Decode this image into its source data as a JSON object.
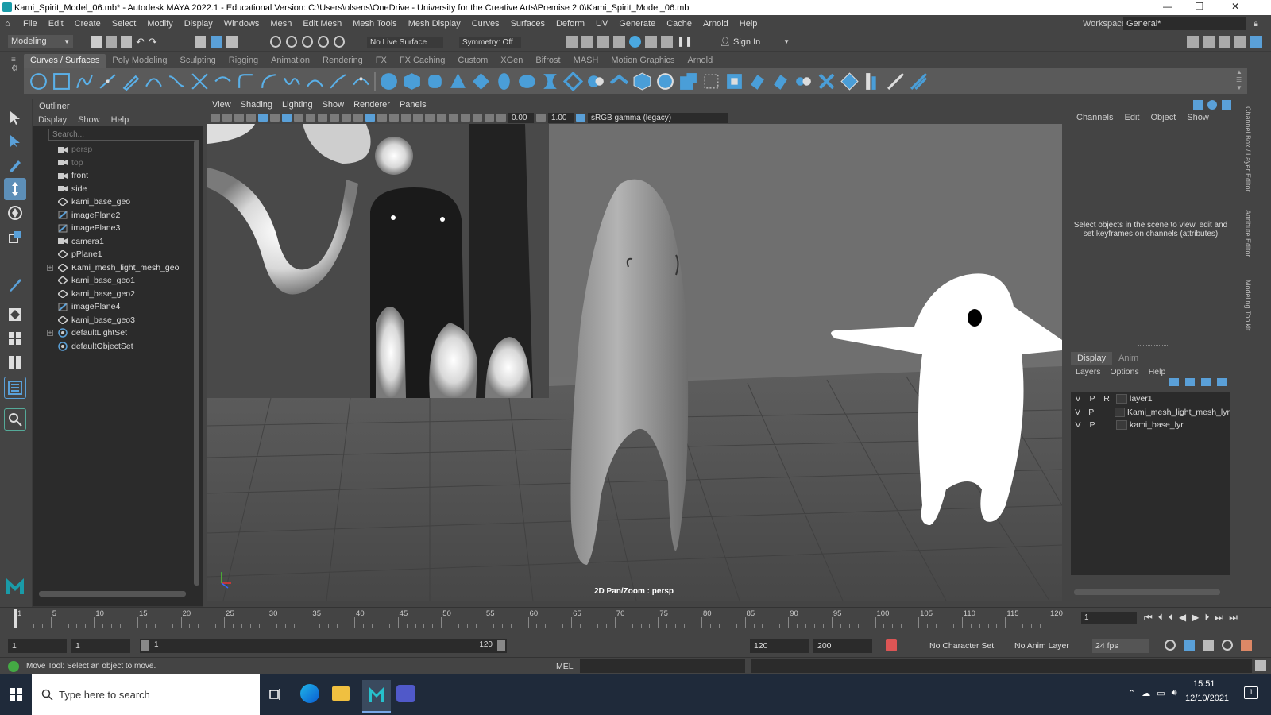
{
  "window": {
    "title": "Kami_Spirit_Model_06.mb* - Autodesk MAYA 2022.1 - Educational Version: C:\\Users\\olsens\\OneDrive - University for the Creative Arts\\Premise 2.0\\Kami_Spirit_Model_06.mb",
    "minimize": "—",
    "maximize": "❐",
    "close": "✕"
  },
  "menu": [
    "File",
    "Edit",
    "Create",
    "Select",
    "Modify",
    "Display",
    "Windows",
    "Mesh",
    "Edit Mesh",
    "Mesh Tools",
    "Mesh Display",
    "Curves",
    "Surfaces",
    "Deform",
    "UV",
    "Generate",
    "Cache",
    "Arnold",
    "Help"
  ],
  "workspace": {
    "label": "Workspace:",
    "value": "General*"
  },
  "status": {
    "menuset": "Modeling",
    "live_surface": "No Live Surface",
    "symmetry": "Symmetry: Off",
    "sign_in": "Sign In"
  },
  "shelf_tabs": [
    "Curves / Surfaces",
    "Poly Modeling",
    "Sculpting",
    "Rigging",
    "Animation",
    "Rendering",
    "FX",
    "FX Caching",
    "Custom",
    "XGen",
    "Bifrost",
    "MASH",
    "Motion Graphics",
    "Arnold"
  ],
  "outliner": {
    "title": "Outliner",
    "menu": [
      "Display",
      "Show",
      "Help"
    ],
    "search_placeholder": "Search...",
    "items": [
      {
        "label": "persp",
        "icon": "camera-icon",
        "dim": true
      },
      {
        "label": "top",
        "icon": "camera-icon",
        "dim": true
      },
      {
        "label": "front",
        "icon": "camera-icon",
        "dim": false
      },
      {
        "label": "side",
        "icon": "camera-icon",
        "dim": false
      },
      {
        "label": "kami_base_geo",
        "icon": "mesh-icon",
        "dim": false
      },
      {
        "label": "imagePlane2",
        "icon": "image-plane-icon",
        "dim": false
      },
      {
        "label": "imagePlane3",
        "icon": "image-plane-icon",
        "dim": false
      },
      {
        "label": "camera1",
        "icon": "camera-icon",
        "dim": false
      },
      {
        "label": "pPlane1",
        "icon": "mesh-icon",
        "dim": false
      },
      {
        "label": "Kami_mesh_light_mesh_geo",
        "icon": "mesh-icon",
        "dim": false,
        "expand": true
      },
      {
        "label": "kami_base_geo1",
        "icon": "mesh-icon",
        "dim": false
      },
      {
        "label": "kami_base_geo2",
        "icon": "mesh-icon",
        "dim": false
      },
      {
        "label": "imagePlane4",
        "icon": "image-plane-icon",
        "dim": false
      },
      {
        "label": "kami_base_geo3",
        "icon": "mesh-icon",
        "dim": false
      },
      {
        "label": "defaultLightSet",
        "icon": "set-icon",
        "dim": false,
        "expand": true
      },
      {
        "label": "defaultObjectSet",
        "icon": "set-icon",
        "dim": false
      }
    ]
  },
  "viewport": {
    "menu": [
      "View",
      "Shading",
      "Lighting",
      "Show",
      "Renderer",
      "Panels"
    ],
    "exposure": "0.00",
    "gamma": "1.00",
    "colorspace": "sRGB gamma (legacy)",
    "hud": "2D Pan/Zoom : persp"
  },
  "channel_box": {
    "menu": [
      "Channels",
      "Edit",
      "Object",
      "Show"
    ],
    "message": "Select objects in the scene to view, edit and set keyframes on channels (attributes)",
    "layer_tabs": [
      "Display",
      "Anim"
    ],
    "layer_menu": [
      "Layers",
      "Options",
      "Help"
    ],
    "layers": [
      {
        "v": "V",
        "p": "P",
        "r": "R",
        "name": "layer1"
      },
      {
        "v": "V",
        "p": "P",
        "r": "",
        "name": "Kami_mesh_light_mesh_lyr"
      },
      {
        "v": "V",
        "p": "P",
        "r": "",
        "name": "kami_base_lyr"
      }
    ]
  },
  "side_tabs": [
    "Channel Box / Layer Editor",
    "Attribute Editor",
    "Modeling Toolkit"
  ],
  "timeline": {
    "ticks": [
      "1",
      "5",
      "10",
      "15",
      "20",
      "25",
      "30",
      "35",
      "40",
      "45",
      "50",
      "55",
      "60",
      "65",
      "70",
      "75",
      "80",
      "85",
      "90",
      "95",
      "100",
      "105",
      "110",
      "115",
      "120"
    ],
    "current": "1"
  },
  "range": {
    "start": "1",
    "play_start": "1",
    "slider_start": "1",
    "slider_end": "120",
    "play_end": "120",
    "end": "200",
    "character_set": "No Character Set",
    "anim_layer": "No Anim Layer",
    "fps": "24 fps"
  },
  "cmd": {
    "help": "Move Tool: Select an object to move.",
    "lang": "MEL"
  },
  "taskbar": {
    "search": "Type here to search",
    "time": "15:51",
    "date": "12/10/2021"
  }
}
